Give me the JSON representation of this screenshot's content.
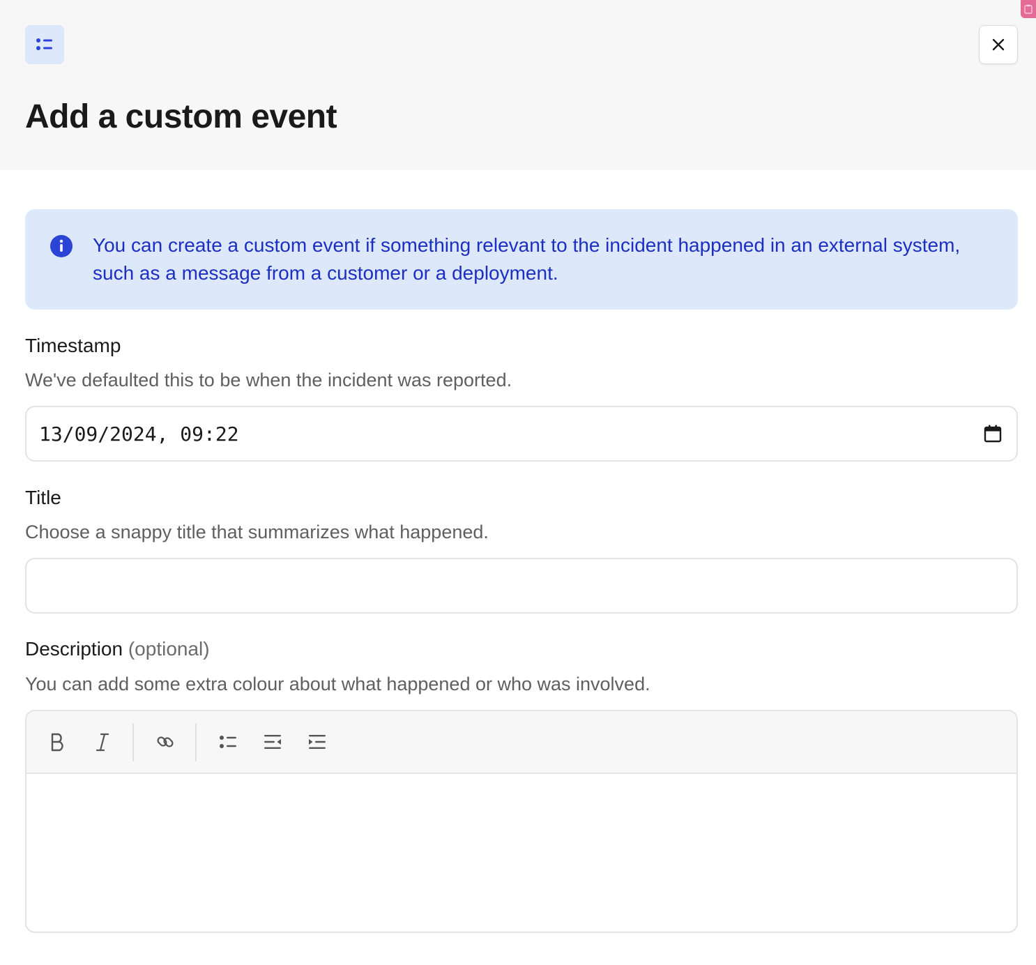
{
  "header": {
    "title": "Add a custom event",
    "icon": "list-icon",
    "close_icon": "close-icon"
  },
  "callout": {
    "icon": "info-icon",
    "text": "You can create a custom event if something relevant to the incident happened in an external system, such as a message from a customer or a deployment."
  },
  "timestamp": {
    "label": "Timestamp",
    "help": "We've defaulted this to be when the incident was reported.",
    "value": "13/09/2024, 09:22",
    "icon": "calendar-icon"
  },
  "title_field": {
    "label": "Title",
    "help": "Choose a snappy title that summarizes what happened.",
    "value": ""
  },
  "description": {
    "label": "Description",
    "optional": "(optional)",
    "help": "You can add some extra colour about what happened or who was involved.",
    "value": "",
    "toolbar": [
      "bold-icon",
      "italic-icon",
      "link-icon",
      "bullet-list-icon",
      "outdent-icon",
      "indent-icon"
    ]
  },
  "colors": {
    "accent": "#1c2fc2",
    "callout_bg": "#dde8fb",
    "header_bg": "#f7f7f7",
    "corner_tab": "#e56b97"
  }
}
